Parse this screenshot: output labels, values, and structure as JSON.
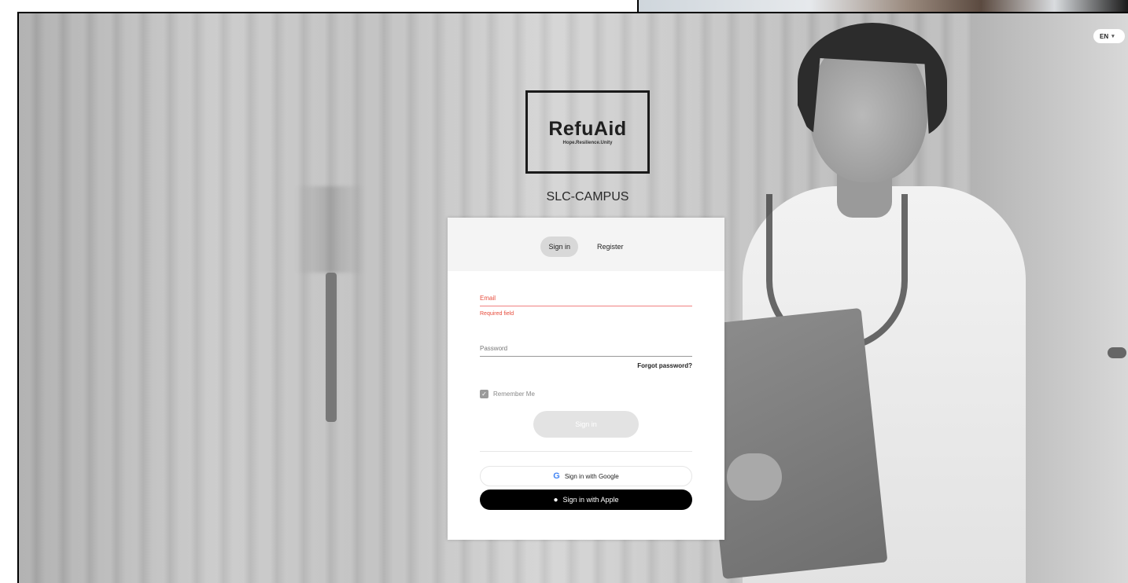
{
  "language": {
    "selected": "EN"
  },
  "brand": {
    "name": "RefuAid",
    "tagline": "Hope.Resilience.Unity",
    "campus": "SLC-CAMPUS"
  },
  "tabs": [
    {
      "label": "Sign in",
      "active": true
    },
    {
      "label": "Register",
      "active": false
    }
  ],
  "form": {
    "email_label": "Email",
    "email_error": "Required field",
    "password_label": "Password",
    "forgot_label": "Forgot password?",
    "remember_label": "Remember Me",
    "remember_checked": true,
    "signin_label": "Sign in"
  },
  "social": {
    "google_label": "Sign in with Google",
    "apple_label": "Sign in with Apple"
  },
  "colors": {
    "error": "#e74c3c",
    "apple_button": "#000000"
  }
}
